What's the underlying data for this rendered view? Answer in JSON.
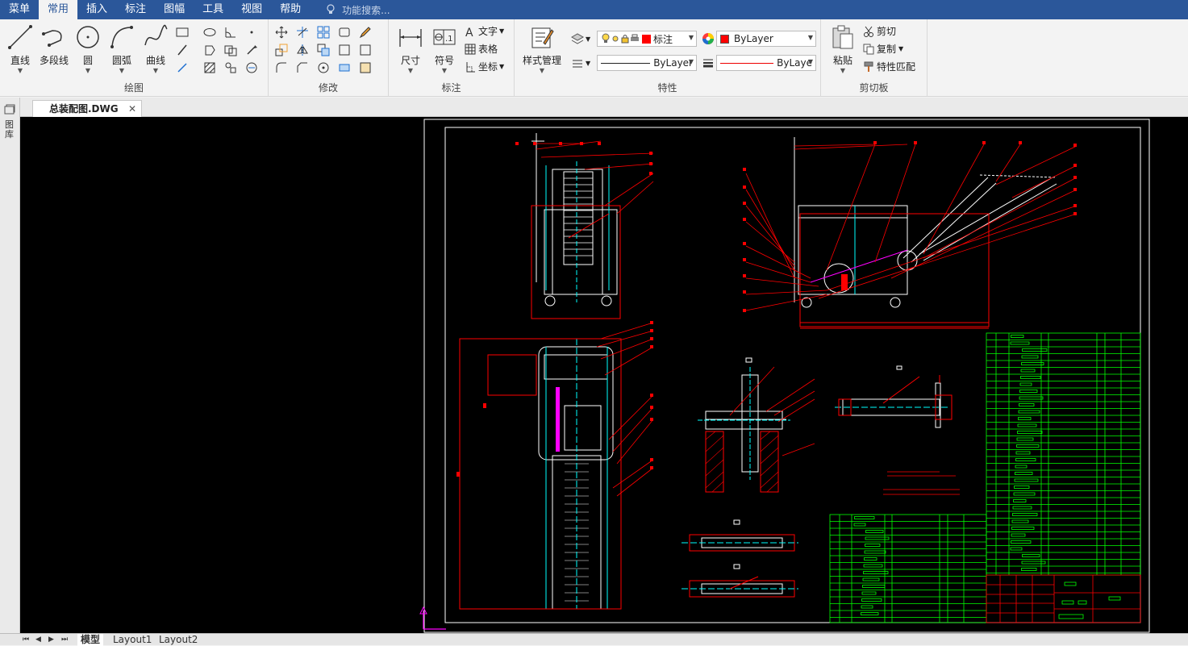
{
  "menubar": {
    "items": [
      "菜单",
      "常用",
      "插入",
      "标注",
      "图幅",
      "工具",
      "视图",
      "帮助"
    ],
    "active_index": 1,
    "search_placeholder": "功能搜索..."
  },
  "ribbon": {
    "draw": {
      "title": "绘图",
      "line": "直线",
      "polyline": "多段线",
      "circle": "圆",
      "arc": "圆弧",
      "curve": "曲线"
    },
    "modify": {
      "title": "修改"
    },
    "annotate": {
      "title": "标注",
      "dimension": "尺寸",
      "symbol": "符号",
      "text": "文字",
      "table": "表格",
      "coord": "坐标"
    },
    "properties": {
      "title": "特性",
      "style_manager": "样式管理",
      "layer_name": "标注",
      "color": "ByLayer",
      "linetype": "ByLayer",
      "lineweight": "ByLaye"
    },
    "clipboard": {
      "title": "剪切板",
      "paste": "粘贴",
      "cut": "剪切",
      "copy": "复制",
      "match": "特性匹配"
    }
  },
  "document": {
    "tab_name": "总装配图.DWG",
    "left_strip_label": "图库"
  },
  "layout_tabs": [
    "模型",
    "Layout1",
    "Layout2"
  ],
  "colors": {
    "menubar": "#2b579a",
    "canvas": "#000000",
    "drawing_red": "#ff0000",
    "drawing_white": "#ffffff",
    "drawing_cyan": "#00ffff",
    "drawing_green": "#00ff00",
    "drawing_magenta": "#ff00ff"
  }
}
